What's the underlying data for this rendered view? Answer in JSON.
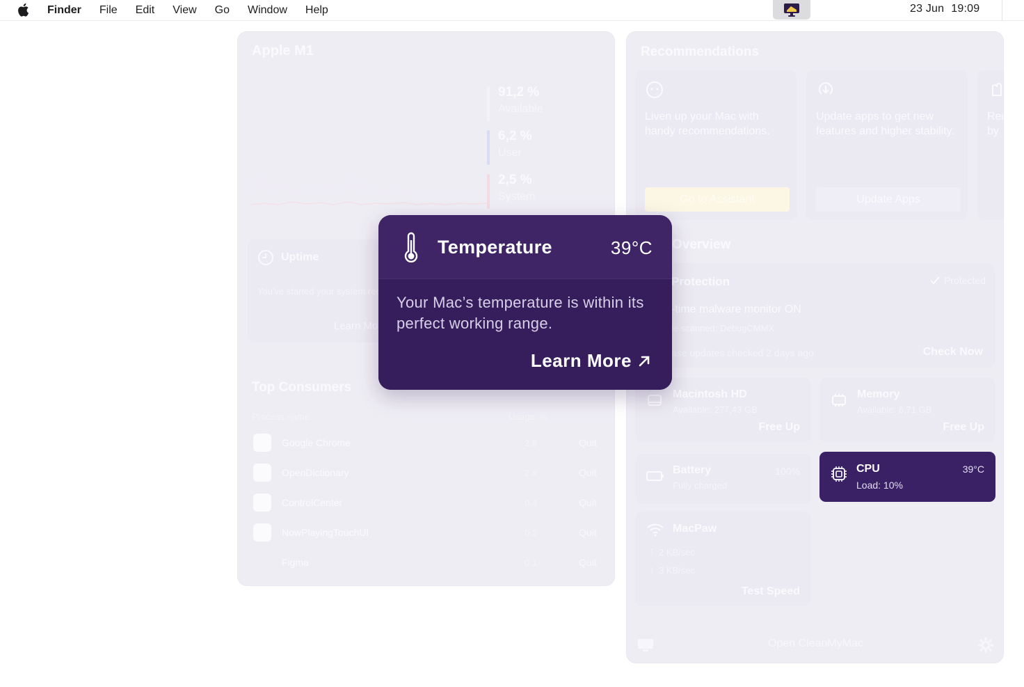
{
  "menubar": {
    "app_name": "Finder",
    "items": [
      "File",
      "Edit",
      "View",
      "Go",
      "Window",
      "Help"
    ],
    "date": "23 Jun",
    "time": "19:09",
    "status_icon": "cleanmymac-menu-icon"
  },
  "left_panel": {
    "title": "Apple M1",
    "stats": [
      {
        "value": "91,2 %",
        "label": "Available",
        "color": "#f7f5fa"
      },
      {
        "value": "6,2 %",
        "label": "User",
        "color": "#d7dcf3"
      },
      {
        "value": "2,5 %",
        "label": "System",
        "color": "#f3dbe2"
      }
    ],
    "uptime": {
      "title": "Uptime",
      "text": "You've started your system recently.",
      "link": "Learn More"
    },
    "consumers": {
      "title": "Top Consumers",
      "col_process": "Process name",
      "col_usage": "Usage, %",
      "rows": [
        {
          "name": "Google Chrome",
          "usage": "2.8",
          "action": "Quit"
        },
        {
          "name": "OpenDictionary",
          "usage": "2.8",
          "action": "Quit"
        },
        {
          "name": "ControlCenter",
          "usage": "0.4",
          "action": "Quit"
        },
        {
          "name": "NowPlayingTouchUI",
          "usage": "0.2",
          "action": "Quit"
        },
        {
          "name": "Figma",
          "usage": "0.1",
          "action": "Quit"
        }
      ]
    }
  },
  "right_panel": {
    "recommendations_title": "Recommendations",
    "recommendations": [
      {
        "text": "Liven up your Mac with handy recommendations.",
        "button": "Go to Assistant",
        "icon": "assistant-icon"
      },
      {
        "text": "Update apps to get new features and higher stability.",
        "button": "Update Apps",
        "icon": "update-icon"
      },
      {
        "text": "Rer by",
        "button": "",
        "icon": "hand-icon"
      }
    ],
    "overview_title": "Overview",
    "protection": {
      "title": "Protection",
      "status": "Protected",
      "line1": "-time malware monitor ON",
      "line2": "le scanned: DebugCMMX",
      "line3": "ase updates checked 2 days ago",
      "action": "Check Now"
    },
    "disk": {
      "title": "Macintosh HD",
      "sub": "Available: 277,43 GB",
      "action": "Free Up"
    },
    "memory": {
      "title": "Memory",
      "sub": "Available: 6,71 GB",
      "action": "Free Up"
    },
    "battery": {
      "title": "Battery",
      "sub": "Fully charged",
      "value": "100%"
    },
    "cpu": {
      "title": "CPU",
      "sub": "Load: 10%",
      "temp": "39°C"
    },
    "network": {
      "title": "MacPaw",
      "upload": "2 KB/sec",
      "download": "3 KB/sec",
      "action": "Test Speed"
    },
    "footer": "Open CleanMyMac"
  },
  "popover": {
    "title": "Temperature",
    "value": "39°C",
    "description": "Your Mac’s temperature is within its perfect working range.",
    "link": "Learn More",
    "icon": "thermometer-icon"
  },
  "colors": {
    "accent": "#3c2163",
    "assistant_button": "#fbf7e4",
    "panel_bg": "#efedf4"
  }
}
